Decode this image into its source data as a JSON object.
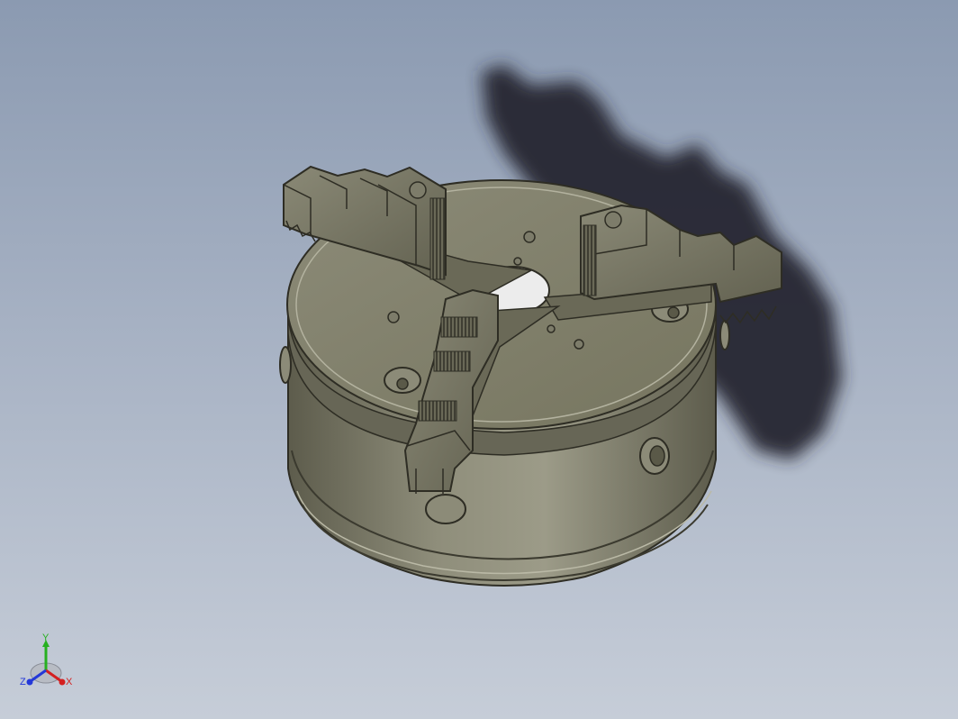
{
  "triad": {
    "y_label": "Y",
    "z_label": "Z",
    "x_label": "X",
    "colors": {
      "x": "#d42020",
      "y": "#26b020",
      "z": "#2438d8"
    }
  },
  "model": {
    "body_color": "#7d7c6a",
    "body_light": "#9a9986",
    "body_dark": "#5a5948",
    "shadow_color": "#2a2c33"
  }
}
